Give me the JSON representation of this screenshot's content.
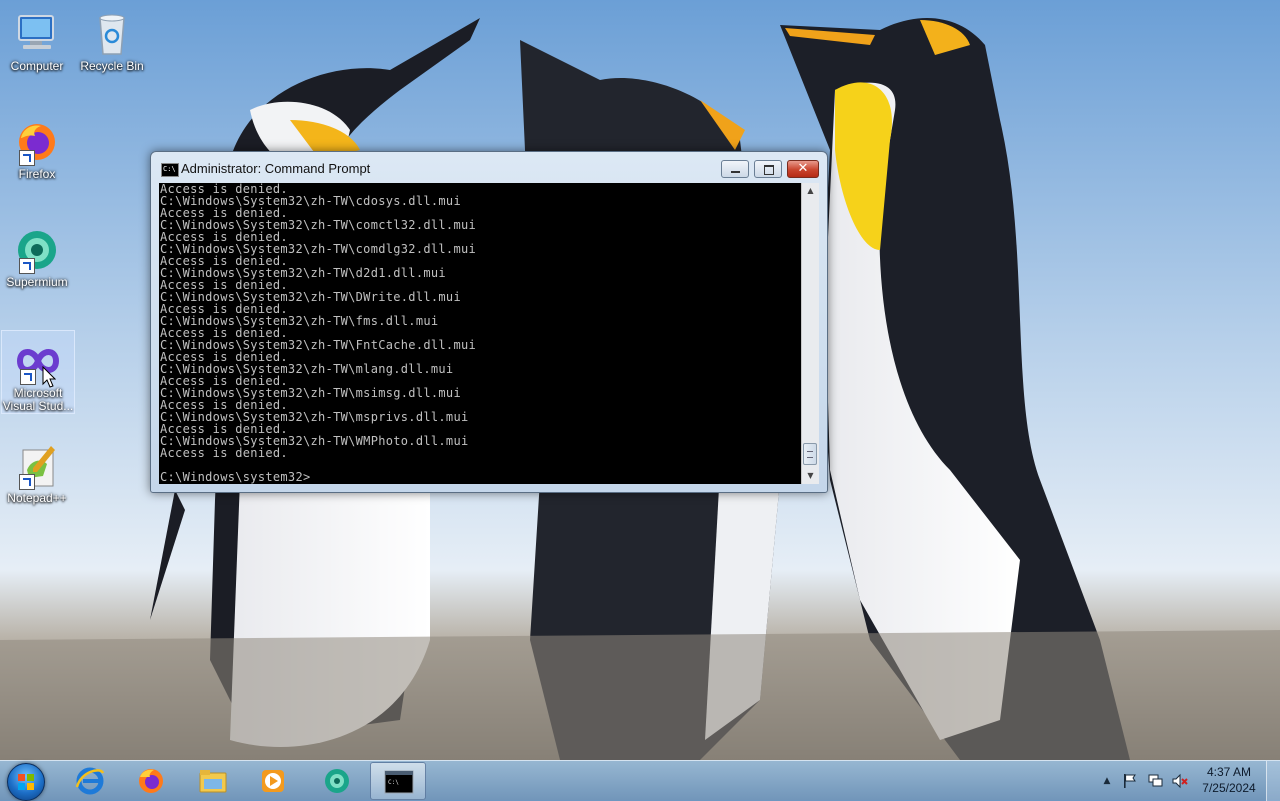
{
  "desktop": {
    "icons": [
      {
        "label": "Computer"
      },
      {
        "label": "Recycle Bin"
      },
      {
        "label": "Firefox"
      },
      {
        "label": "Supermium"
      },
      {
        "label": "Microsoft Visual Stud..."
      },
      {
        "label": "Notepad++"
      }
    ]
  },
  "cmd_window": {
    "title": "Administrator: Command Prompt",
    "title_icon_text": "C:\\",
    "close_glyph": "✕",
    "lines": [
      "Access is denied.",
      "C:\\Windows\\System32\\zh-TW\\cdosys.dll.mui",
      "Access is denied.",
      "C:\\Windows\\System32\\zh-TW\\comctl32.dll.mui",
      "Access is denied.",
      "C:\\Windows\\System32\\zh-TW\\comdlg32.dll.mui",
      "Access is denied.",
      "C:\\Windows\\System32\\zh-TW\\d2d1.dll.mui",
      "Access is denied.",
      "C:\\Windows\\System32\\zh-TW\\DWrite.dll.mui",
      "Access is denied.",
      "C:\\Windows\\System32\\zh-TW\\fms.dll.mui",
      "Access is denied.",
      "C:\\Windows\\System32\\zh-TW\\FntCache.dll.mui",
      "Access is denied.",
      "C:\\Windows\\System32\\zh-TW\\mlang.dll.mui",
      "Access is denied.",
      "C:\\Windows\\System32\\zh-TW\\msimsg.dll.mui",
      "Access is denied.",
      "C:\\Windows\\System32\\zh-TW\\msprivs.dll.mui",
      "Access is denied.",
      "C:\\Windows\\System32\\zh-TW\\WMPhoto.dll.mui",
      "Access is denied.",
      "",
      "C:\\Windows\\system32>"
    ]
  },
  "taskbar": {
    "pinned": [
      {
        "icon": "internet-explorer-icon"
      },
      {
        "icon": "firefox-icon"
      },
      {
        "icon": "file-explorer-icon"
      },
      {
        "icon": "media-player-icon"
      },
      {
        "icon": "supermium-icon"
      },
      {
        "icon": "command-prompt-icon",
        "active": true
      }
    ],
    "clock": {
      "time": "4:37 AM",
      "date": "7/25/2024"
    }
  },
  "colors": {
    "console_bg": "#000000",
    "console_text": "#c0c0c0",
    "close_red": "#c9442d"
  }
}
